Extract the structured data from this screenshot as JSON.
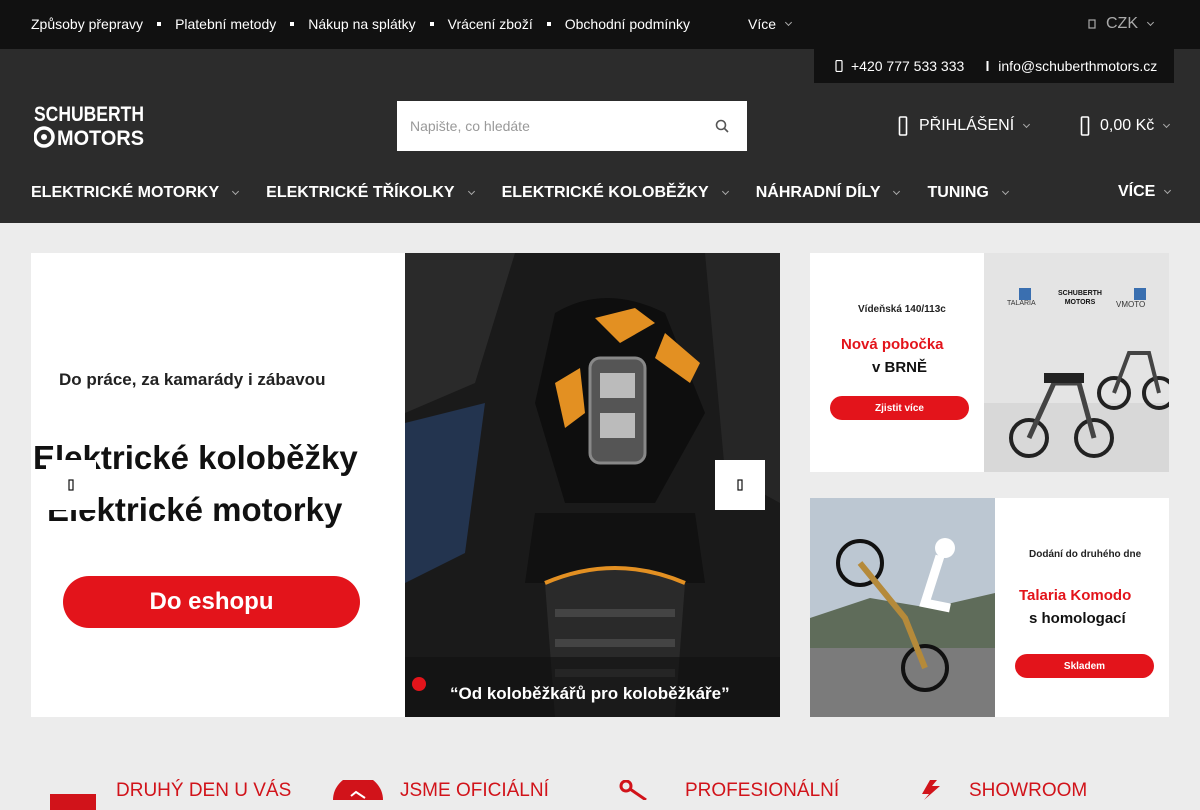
{
  "topbar": {
    "links": [
      "Způsoby přepravy",
      "Platební metody",
      "Nákup na splátky",
      "Vrácení zboží",
      "Obchodní podmínky"
    ],
    "more_label": "Více",
    "currency": "CZK"
  },
  "contact": {
    "phone": "+420 777 533 333",
    "email": "info@schuberthmotors.cz"
  },
  "logo": {
    "line1": "SCHUBERTH",
    "line2": "MOTORS"
  },
  "search": {
    "placeholder": "Napište, co hledáte"
  },
  "account": {
    "login_label": "PŘIHLÁŠENÍ"
  },
  "cart": {
    "total": "0,00 Kč"
  },
  "nav": {
    "items": [
      "ELEKTRICKÉ MOTORKY",
      "ELEKTRICKÉ TŘÍKOLKY",
      "ELEKTRICKÉ KOLOBĚŽKY",
      "NÁHRADNÍ DÍLY",
      "TUNING"
    ],
    "more_label": "VÍCE"
  },
  "slider": {
    "tagline": "Do práce, za kamarády i zábavou",
    "headline1": "Elektrické koloběžky",
    "headline2": "Elektrické motorky",
    "cta": "Do eshopu",
    "quote": "“Od koloběžkářů pro koloběžkáře”",
    "active_slide": 1,
    "slide_count": 2
  },
  "banner1": {
    "address": "Vídeňská 140/113c",
    "title1": "Nová pobočka",
    "title2": "v BRNĚ",
    "cta": "Zjistit více",
    "brands": [
      "TALARIA",
      "SCHUBERTH MOTORS",
      "VMOTO"
    ]
  },
  "banner2": {
    "note": "Dodání do druhého dne",
    "title1": "Talaria Komodo",
    "title2": "s homologací",
    "cta": "Skladem"
  },
  "features": [
    "DRUHÝ DEN U VÁS",
    "JSME OFICIÁLNÍ",
    "PROFESIONÁLNÍ",
    "SHOWROOM"
  ],
  "colors": {
    "accent": "#d1131a",
    "topbar": "#111111",
    "header": "#2c2c2c"
  }
}
